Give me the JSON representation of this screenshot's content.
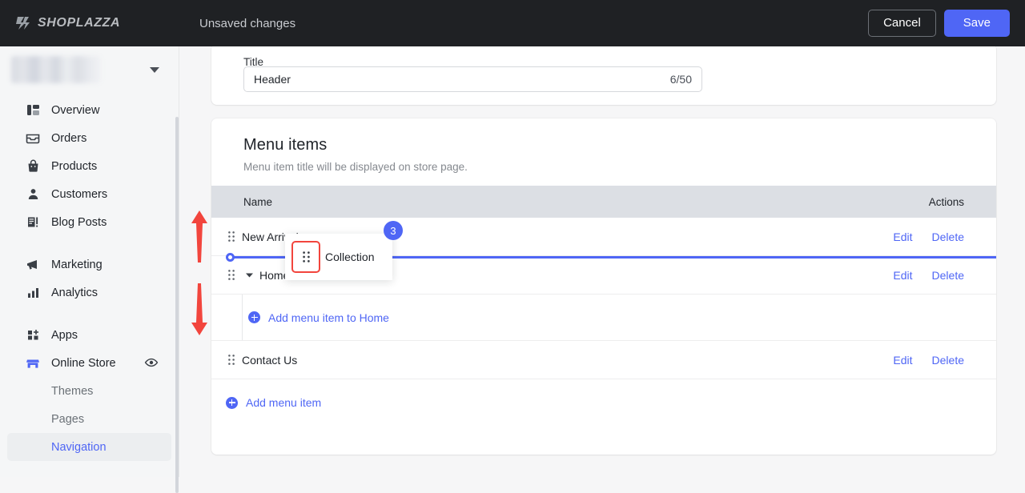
{
  "topbar": {
    "brand": "SHOPLAZZA",
    "brand_icon": "shoplazza-logo-icon",
    "status_text": "Unsaved changes",
    "cancel_label": "Cancel",
    "save_label": "Save",
    "bg_color": "#1f2124",
    "accent_color": "#4f66f5"
  },
  "sidebar": {
    "store_switcher": {
      "name": "",
      "caret_icon": "chevron-down-icon"
    },
    "items": [
      {
        "label": "Overview",
        "icon": "overview-icon",
        "active": false
      },
      {
        "label": "Orders",
        "icon": "orders-icon",
        "active": false
      },
      {
        "label": "Products",
        "icon": "products-icon",
        "active": false
      },
      {
        "label": "Customers",
        "icon": "customers-icon",
        "active": false
      },
      {
        "label": "Blog Posts",
        "icon": "blog-icon",
        "active": false
      },
      {
        "label": "Marketing",
        "icon": "marketing-icon",
        "active": false
      },
      {
        "label": "Analytics",
        "icon": "analytics-icon",
        "active": false
      },
      {
        "label": "Apps",
        "icon": "apps-icon",
        "active": false
      },
      {
        "label": "Online Store",
        "icon": "store-icon",
        "active": false,
        "trailing_icon": "eye-icon"
      }
    ],
    "sub_items": [
      {
        "label": "Themes",
        "active": false
      },
      {
        "label": "Pages",
        "active": false
      },
      {
        "label": "Navigation",
        "active": true
      }
    ]
  },
  "title_card": {
    "label": "Title",
    "value": "Header",
    "placeholder": "Title",
    "counter": "6/50"
  },
  "menu_card": {
    "heading": "Menu items",
    "subheading": "Menu item title will be displayed on store page.",
    "columns": {
      "name": "Name",
      "actions": "Actions"
    },
    "rows": [
      {
        "name": "New Arrivals",
        "edit": "Edit",
        "delete": "Delete",
        "expandable": false,
        "drag_icon": "drag-handle-icon"
      },
      {
        "name": "Home",
        "edit": "Edit",
        "delete": "Delete",
        "expandable": true,
        "drag_icon": "drag-handle-icon",
        "expander_icon": "caret-down-icon"
      },
      {
        "name": "Contact Us",
        "edit": "Edit",
        "delete": "Delete",
        "expandable": false,
        "drag_icon": "drag-handle-icon"
      }
    ],
    "sub_add_label": "Add menu item to Home",
    "footer_add_label": "Add menu item",
    "add_icon": "plus-circle-icon"
  },
  "drag_state": {
    "ghost_label": "Collection",
    "ghost_handle_icon": "drag-handle-icon",
    "badge_count": "3",
    "drop_indicator_color": "#4f66f5",
    "highlight_color": "#f2453d"
  },
  "annotations": {
    "arrow_up_icon": "red-arrow-up-icon",
    "arrow_down_icon": "red-arrow-down-icon",
    "arrow_color": "#f2453d"
  }
}
